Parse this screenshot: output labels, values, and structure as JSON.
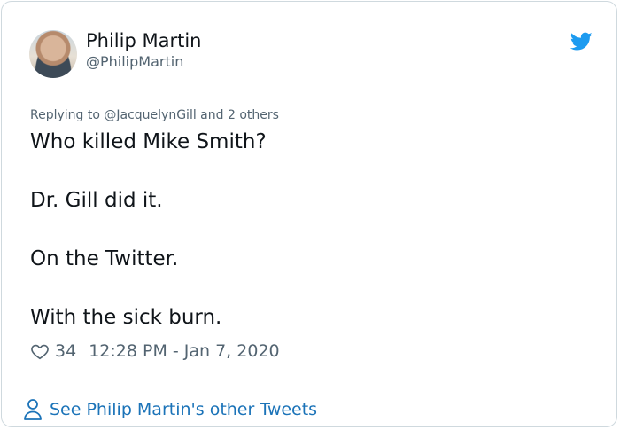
{
  "author": {
    "name": "Philip Martin",
    "handle": "@PhilipMartin"
  },
  "tweet": {
    "replying_to": "Replying to @JacquelynGill and 2 others",
    "lines": [
      "Who killed Mike Smith?",
      "Dr. Gill did it.",
      "On the Twitter.",
      "With the sick burn."
    ],
    "likes": "34",
    "timestamp": "12:28 PM - Jan 7, 2020"
  },
  "footer": {
    "label": "See Philip Martin's other Tweets"
  },
  "colors": {
    "twitter_blue": "#1d9bf0",
    "link_blue": "#1b73b8",
    "secondary_text": "#536471"
  },
  "icons": {
    "brand": "twitter-bird-icon",
    "like": "heart-outline-icon",
    "profile": "person-outline-icon"
  }
}
